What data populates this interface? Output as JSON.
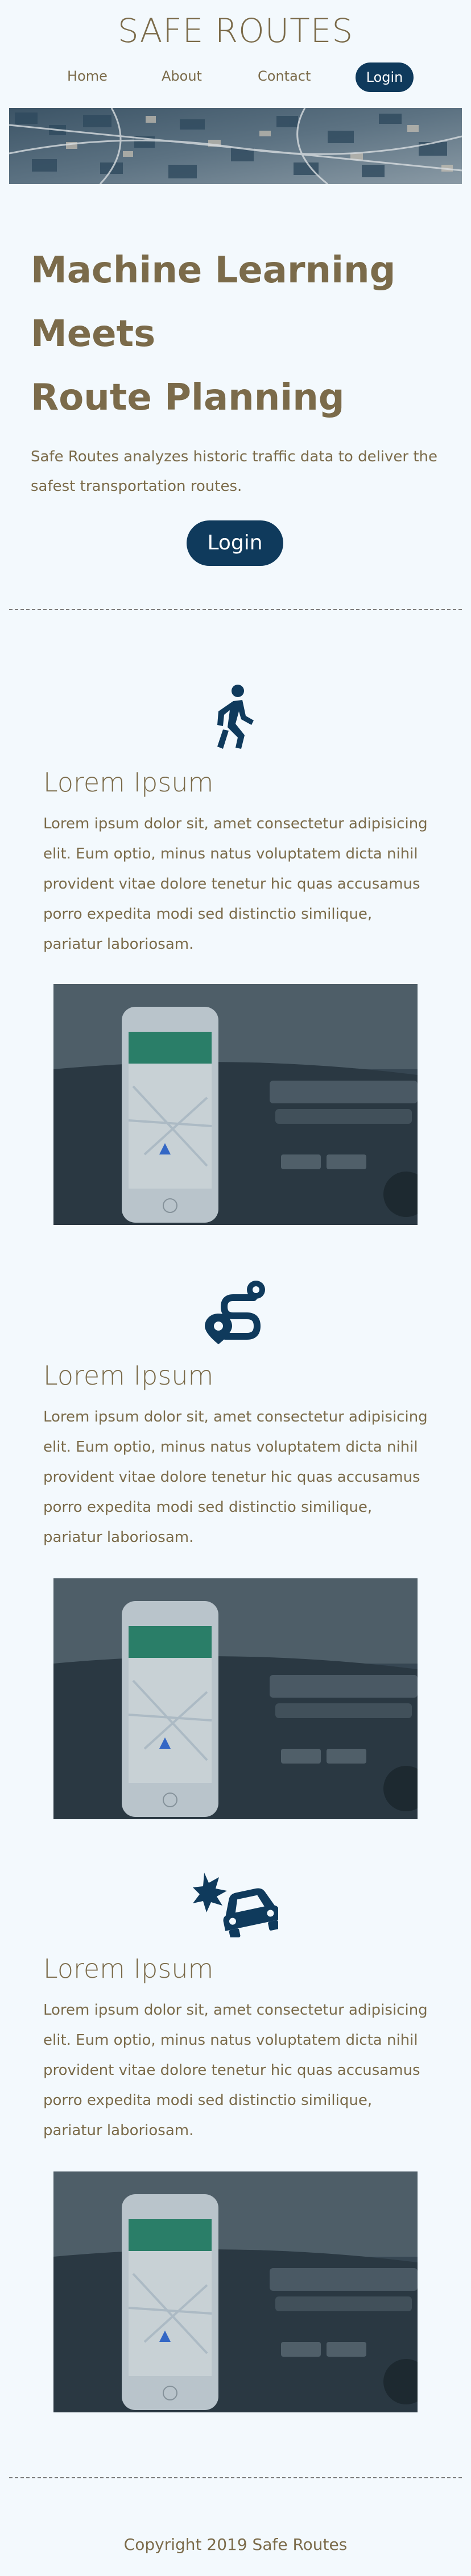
{
  "site": {
    "title": "SAFE ROUTES"
  },
  "nav": {
    "home": "Home",
    "about": "About",
    "contact": "Contact",
    "login": "Login"
  },
  "hero": {
    "headline_line1": "Machine Learning",
    "headline_line2": "Meets",
    "headline_line3": "Route Planning",
    "intro": "Safe Routes analyzes historic traffic data to deliver the safest transportation routes.",
    "login": "Login"
  },
  "features": [
    {
      "icon": "walking-person-icon",
      "heading": "Lorem Ipsum",
      "text": "Lorem ipsum dolor sit, amet consectetur adipisicing elit. Eum optio, minus natus voluptatem dicta nihil provident vitae dolore tenetur hic quas accusamus porro expedita modi sed distinctio similique, pariatur laboriosam."
    },
    {
      "icon": "route-pin-icon",
      "heading": "Lorem Ipsum",
      "text": "Lorem ipsum dolor sit, amet consectetur adipisicing elit. Eum optio, minus natus voluptatem dicta nihil provident vitae dolore tenetur hic quas accusamus porro expedita modi sed distinctio similique, pariatur laboriosam."
    },
    {
      "icon": "car-crash-icon",
      "heading": "Lorem Ipsum",
      "text": "Lorem ipsum dolor sit, amet consectetur adipisicing elit. Eum optio, minus natus voluptatem dicta nihil provident vitae dolore tenetur hic quas accusamus porro expedita modi sed distinctio similique, pariatur laboriosam."
    }
  ],
  "footer": {
    "copyright": "Copyright 2019 Safe Routes"
  },
  "colors": {
    "accent": "#0f3a5c",
    "text": "#7b6b4a",
    "background": "#f3f9fd"
  }
}
